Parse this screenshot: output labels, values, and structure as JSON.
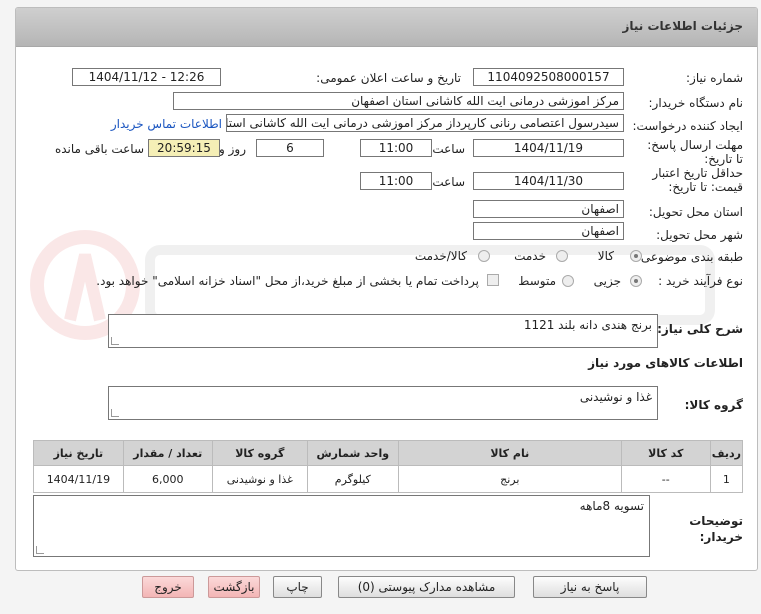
{
  "panel_title": "جزئیات اطلاعات نیاز",
  "fields": {
    "need_number_label": "شماره نیاز:",
    "need_number": "1104092508000157",
    "announce_label": "تاریخ و ساعت اعلان عمومی:",
    "announce_value": "1404/11/12 - 12:26",
    "buyer_label": "نام دستگاه خریدار:",
    "buyer_value": "مرکز اموزشی درمانی ایت الله کاشانی استان اصفهان",
    "creator_label": "ایجاد کننده درخواست:",
    "creator_value": "سیدرسول اعتصامی رنانی کارپرداز مرکز اموزشی درمانی ایت الله کاشانی استان",
    "contact_link": "اطلاعات تماس خریدار",
    "deadline_label": "مهلت ارسال پاسخ: تا تاریخ:",
    "deadline_date": "1404/11/19",
    "time_label": "ساعت",
    "deadline_time": "11:00",
    "days_value": "6",
    "days_label": "روز و",
    "remaining_value": "20:59:15",
    "remaining_label": "ساعت باقی مانده",
    "validity_label": "حداقل تاریخ اعتبار قیمت: تا تاریخ:",
    "validity_date": "1404/11/30",
    "validity_time": "11:00",
    "province_label": "استان محل تحویل:",
    "province_value": "اصفهان",
    "city_label": "شهر محل تحویل:",
    "city_value": "اصفهان",
    "category_label": "طبقه بندی موضوعی:",
    "category_options": [
      "کالا",
      "خدمت",
      "کالا/خدمت"
    ],
    "process_label": "نوع فرآیند خرید :",
    "process_options": [
      "جزیی",
      "متوسط"
    ],
    "payment_note": "پرداخت تمام یا بخشی از مبلغ خرید،از محل \"اسناد خزانه اسلامی\" خواهد بود."
  },
  "description": {
    "label": "شرح کلی نیاز:",
    "value": "برنج هندی دانه بلند 1121"
  },
  "goods_section_title": "اطلاعات کالاهای مورد نیاز",
  "goods_group": {
    "label": "گروه کالا:",
    "value": "غذا و نوشیدنی"
  },
  "table": {
    "headers": [
      "ردیف",
      "کد کالا",
      "نام کالا",
      "واحد شمارش",
      "گروه کالا",
      "تعداد / مقدار",
      "تاریخ نیاز"
    ],
    "rows": [
      [
        "1",
        "--",
        "برنج",
        "کیلوگرم",
        "غذا و نوشیدنی",
        "6,000",
        "1404/11/19"
      ]
    ]
  },
  "buyer_notes": {
    "label": "توضیحات خریدار:",
    "value": "تسویه 8ماهه"
  },
  "buttons": {
    "reply": "پاسخ به نیاز",
    "attachments": "مشاهده مدارک پیوستی (0)",
    "print": "چاپ",
    "back": "بازگشت",
    "exit": "خروج"
  },
  "colors": {
    "header_bg": "#bdbdbd",
    "link": "#1a55c0",
    "remaining_bg": "#f5efb6",
    "exit_bg": "#f3b5b5"
  }
}
